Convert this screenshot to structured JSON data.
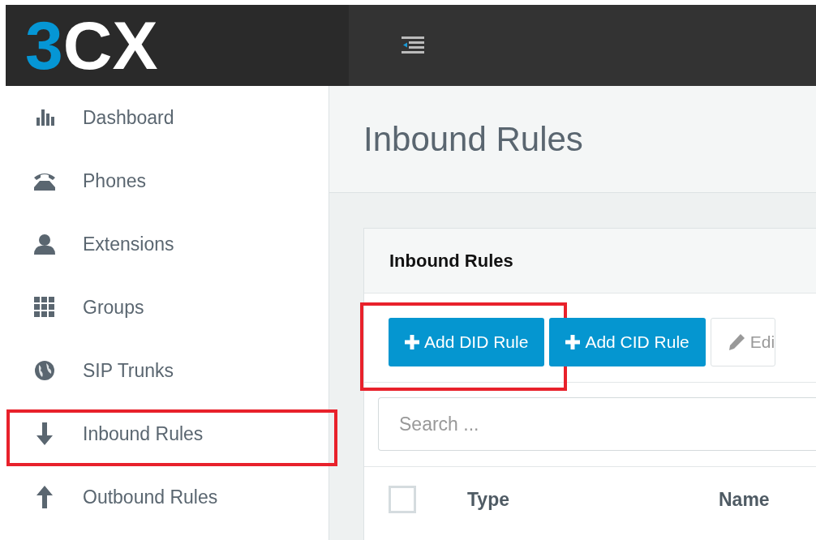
{
  "logo": {
    "accent": "3",
    "rest": "CX"
  },
  "sidebar": {
    "items": [
      {
        "label": "Dashboard",
        "kind": "bars",
        "selected": false,
        "highlighted": false
      },
      {
        "label": "Phones",
        "kind": "phone",
        "selected": false,
        "highlighted": false
      },
      {
        "label": "Extensions",
        "kind": "user",
        "selected": false,
        "highlighted": false
      },
      {
        "label": "Groups",
        "kind": "grid",
        "selected": false,
        "highlighted": false
      },
      {
        "label": "SIP Trunks",
        "kind": "globe",
        "selected": false,
        "highlighted": false
      },
      {
        "label": "Inbound Rules",
        "kind": "down",
        "selected": false,
        "highlighted": true
      },
      {
        "label": "Outbound Rules",
        "kind": "up",
        "selected": false,
        "highlighted": false
      }
    ]
  },
  "page_title": "Inbound Rules",
  "panel": {
    "title": "Inbound Rules",
    "buttons": [
      {
        "label": "Add DID Rule",
        "kind": "primary",
        "highlighted": true
      },
      {
        "label": "Add CID Rule",
        "kind": "primary",
        "highlighted": false
      },
      {
        "label": "Edi",
        "kind": "default",
        "highlighted": false
      }
    ],
    "search": {
      "placeholder": "Search ..."
    },
    "table": {
      "select_all_checked": false,
      "columns": [
        "Type",
        "Name"
      ]
    }
  }
}
